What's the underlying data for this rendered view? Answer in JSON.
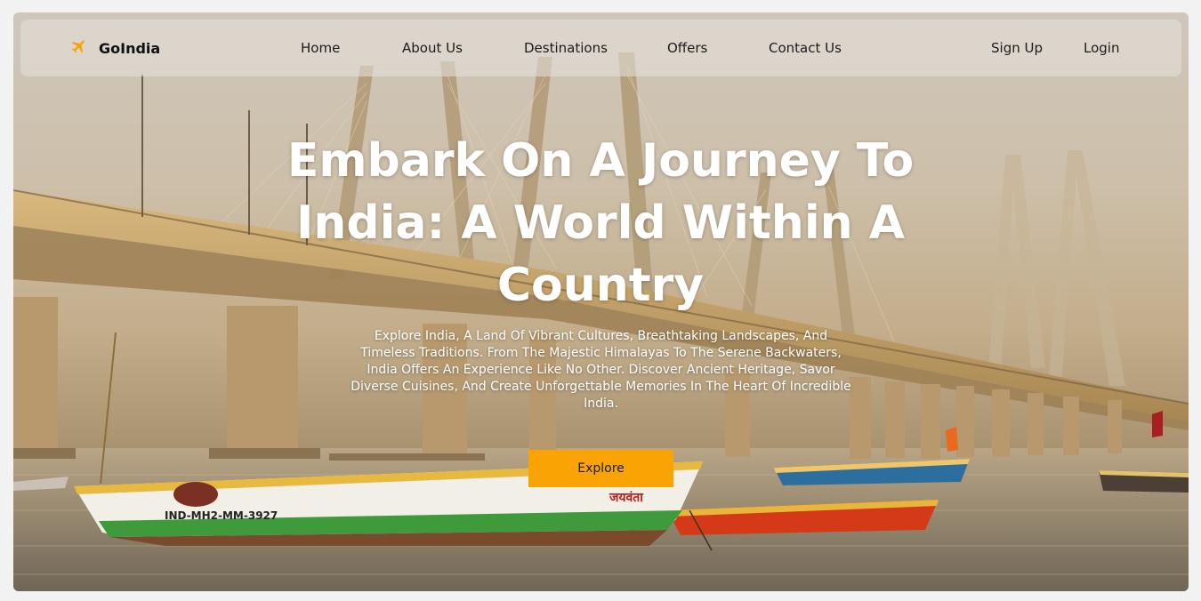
{
  "nav": {
    "brand": "GoIndia",
    "brand_icon": "airplane-icon",
    "links": [
      "Home",
      "About Us",
      "Destinations",
      "Offers",
      "Contact Us"
    ],
    "sign_up": "Sign Up",
    "login": "Login"
  },
  "hero": {
    "title": "Embark On A Journey To India: A World Within A Country",
    "description": "Explore India, A Land Of Vibrant Cultures, Breathtaking Landscapes, And Timeless Traditions. From The Majestic Himalayas To The Serene Backwaters, India Offers An Experience Like No Other. Discover Ancient Heritage, Savor Diverse Cuisines, And Create Unforgettable Memories In The Heart Of Incredible India.",
    "button": "Explore"
  },
  "boat": {
    "registration": "IND-MH2-MM-3927",
    "name": "जयवंता"
  },
  "colors": {
    "accent": "#f9a304",
    "text_on_hero": "#ffffff"
  }
}
